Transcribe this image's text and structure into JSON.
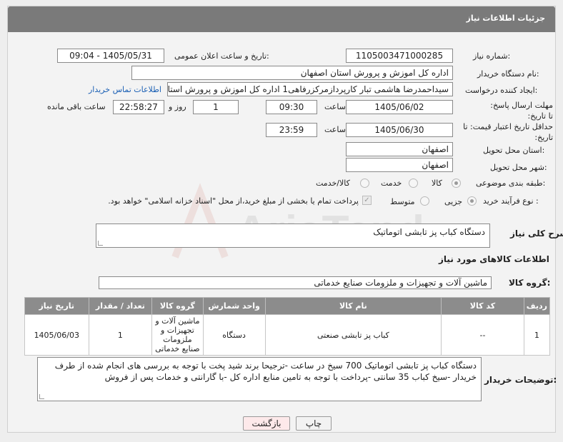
{
  "header": {
    "title": "جزئیات اطلاعات نیاز"
  },
  "labels": {
    "need_number": "شماره نیاز:",
    "announce_datetime": "تاریخ و ساعت اعلان عمومی:",
    "buyer_org": "نام دستگاه خریدار:",
    "requester": "ایجاد کننده درخواست:",
    "reply_deadline": "مهلت ارسال پاسخ: تا تاریخ:",
    "price_validity": "حداقل تاریخ اعتبار قیمت: تا تاریخ:",
    "delivery_province": "استان محل تحویل:",
    "delivery_city": "شهر محل تحویل:",
    "category": "طبقه بندی موضوعی:",
    "process_type": "نوع فرآیند خرید :",
    "hour": "ساعت",
    "day_and": "روز و",
    "remaining": "ساعت باقی مانده",
    "need_description": "شرح کلی نیاز:",
    "goods_info": "اطلاعات کالاهای مورد نیاز",
    "goods_group": "گروه کالا:",
    "buyer_notes": "توضیحات خریدار:"
  },
  "fields": {
    "need_number": "1105003471000285",
    "announce_datetime": "1405/05/31 - 09:04",
    "buyer_org": "اداره کل اموزش و پرورش استان اصفهان",
    "requester": "سیداحمدرضا هاشمی تبار کارپردازمرکزرفاهی1 اداره کل اموزش و پرورش استان اصفهان",
    "buyer_contact_link": "اطلاعات تماس خریدار",
    "reply_date": "1405/06/02",
    "reply_time": "09:30",
    "reply_days": "1",
    "reply_remaining": "22:58:27",
    "price_date": "1405/06/30",
    "price_time": "23:59",
    "delivery_province": "اصفهان",
    "delivery_city": "اصفهان",
    "need_description": "دستگاه کباب پز تابشی اتوماتیک",
    "goods_group": "ماشین آلات و تجهیزات و ملزومات صنایع خدماتی",
    "buyer_notes": "دستگاه کباب پز تابشی اتوماتیک 700 سیخ در ساعت -ترجیحا برند شید پخت با توجه به بررسی های انجام شده از طرف خریدار -سیخ کباب 35 سانتی -پرداخت با توجه به تامین منابع اداره کل -با گارانتی و خدمات پس از فروش"
  },
  "category_options": [
    {
      "label": "کالا",
      "checked": true
    },
    {
      "label": "خدمت",
      "checked": false
    },
    {
      "label": "کالا/خدمت",
      "checked": false
    }
  ],
  "process_options": [
    {
      "label": "جزیی",
      "checked": true
    },
    {
      "label": "متوسط",
      "checked": false
    }
  ],
  "payment_note": "پرداخت تمام یا بخشی از مبلغ خرید،از محل \"اسناد خزانه اسلامی\" خواهد بود.",
  "table": {
    "headers": [
      "ردیف",
      "کد کالا",
      "نام کالا",
      "واحد شمارش",
      "گروه کالا",
      "تعداد / مقدار",
      "تاریخ نیاز"
    ],
    "rows": [
      [
        "1",
        "--",
        "کباب پز تابشی صنعتی",
        "دستگاه",
        "ماشین آلات و تجهیزات و ملزومات صنایع خدماتی",
        "1",
        "1405/06/03"
      ]
    ]
  },
  "buttons": {
    "print": "چاپ",
    "back": "بازگشت"
  },
  "watermark_text": "AriaTender.neT",
  "colors": {
    "header_bg": "#7a7a7a",
    "link": "#1a5fb4",
    "back_button_bg": "#fde9ea"
  }
}
